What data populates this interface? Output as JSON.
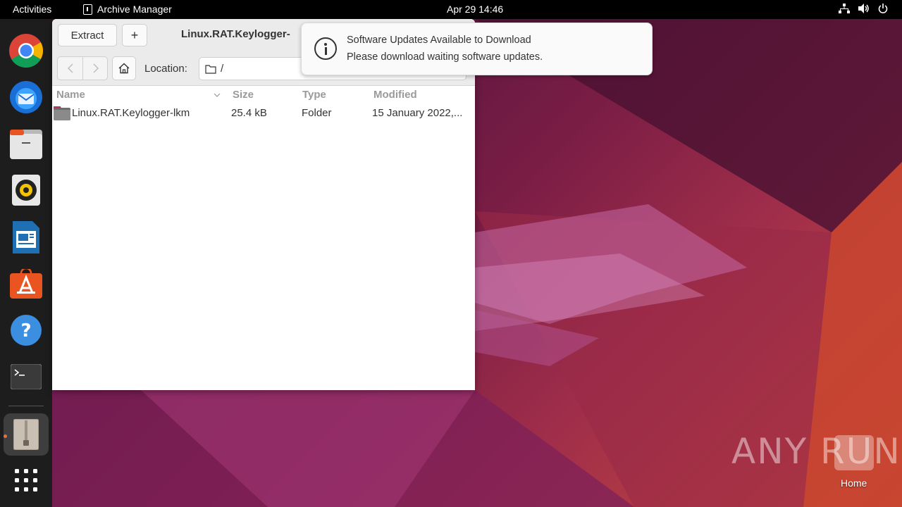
{
  "topbar": {
    "activities": "Activities",
    "app_name": "Archive Manager",
    "clock": "Apr 29  14:46",
    "tray_icons": [
      "network-icon",
      "volume-icon",
      "power-icon"
    ]
  },
  "dock": {
    "items": [
      "chrome-icon",
      "thunderbird-icon",
      "files-icon",
      "rhythmbox-icon",
      "writer-icon",
      "app-center-icon",
      "help-icon",
      "terminal-icon",
      "archive-manager-icon",
      "show-apps-icon"
    ]
  },
  "window": {
    "extract_label": "Extract",
    "add_label": "+",
    "title": "Linux.RAT.Keylogger-",
    "location_label": "Location:",
    "location_value": "/",
    "columns": [
      "Name",
      "Size",
      "Type",
      "Modified"
    ],
    "rows": [
      {
        "name": "Linux.RAT.Keylogger-lkm",
        "size": "25.4 kB",
        "type": "Folder",
        "modified": "15 January 2022,..."
      }
    ]
  },
  "notification": {
    "title": "Software Updates Available to Download",
    "body": "Please download waiting software updates."
  },
  "desktop": {
    "watermark": "ANY RUN",
    "home_label": "Home"
  }
}
